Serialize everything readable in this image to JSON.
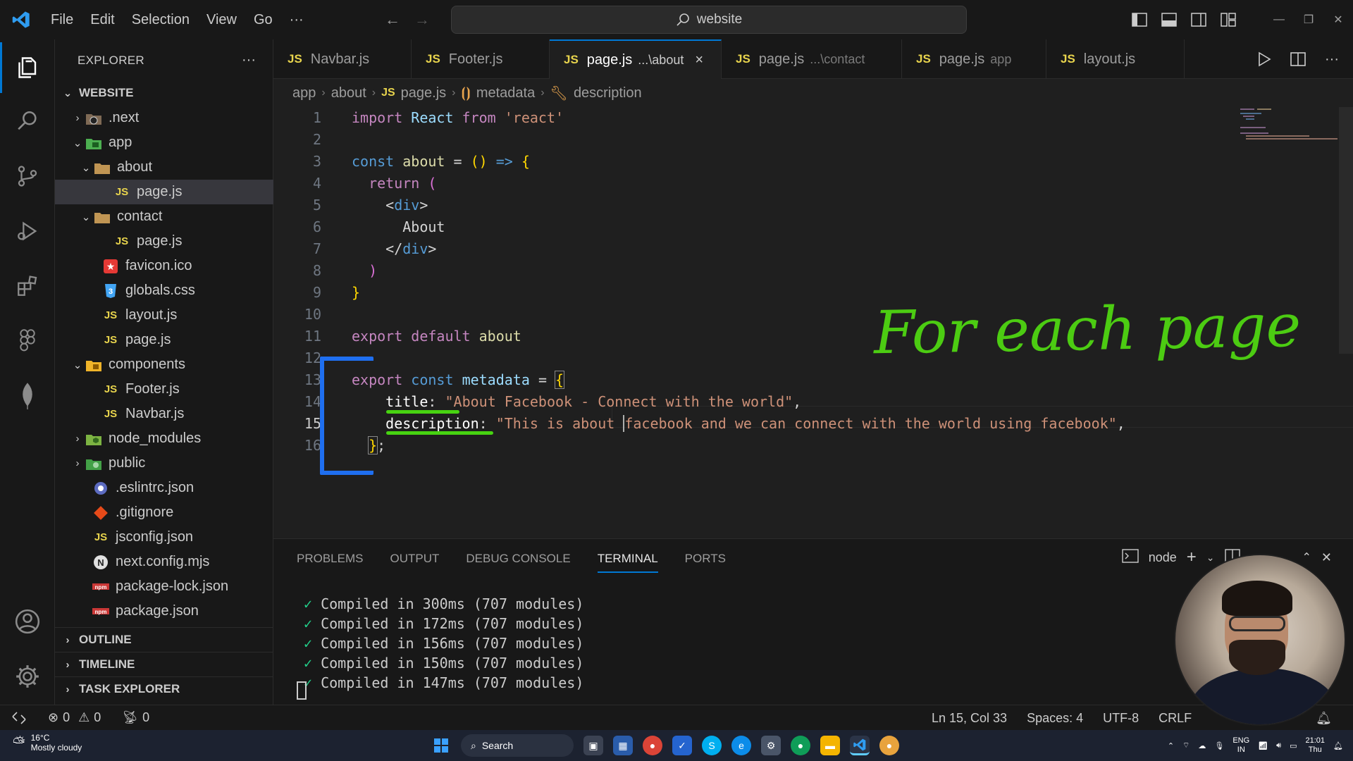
{
  "titlebar": {
    "menu": [
      "File",
      "Edit",
      "Selection",
      "View",
      "Go"
    ],
    "more": "···",
    "search_text": "website"
  },
  "sidebar": {
    "title": "EXPLORER",
    "more": "···",
    "root": "WEBSITE",
    "items": [
      {
        "label": ".next",
        "icon": "folder-next-icon"
      },
      {
        "label": "app",
        "icon": "folder-app-icon"
      },
      {
        "label": "about",
        "icon": "folder-icon"
      },
      {
        "label": "page.js",
        "icon": "js-file-icon"
      },
      {
        "label": "contact",
        "icon": "folder-icon"
      },
      {
        "label": "page.js",
        "icon": "js-file-icon"
      },
      {
        "label": "favicon.ico",
        "icon": "star-file-icon"
      },
      {
        "label": "globals.css",
        "icon": "css-file-icon"
      },
      {
        "label": "layout.js",
        "icon": "js-file-icon"
      },
      {
        "label": "page.js",
        "icon": "js-file-icon"
      },
      {
        "label": "components",
        "icon": "folder-components-icon"
      },
      {
        "label": "Footer.js",
        "icon": "js-file-icon"
      },
      {
        "label": "Navbar.js",
        "icon": "js-file-icon"
      },
      {
        "label": "node_modules",
        "icon": "folder-node-icon"
      },
      {
        "label": "public",
        "icon": "folder-public-icon"
      },
      {
        "label": ".eslintrc.json",
        "icon": "eslint-file-icon"
      },
      {
        "label": ".gitignore",
        "icon": "git-file-icon"
      },
      {
        "label": "jsconfig.json",
        "icon": "json-file-icon"
      },
      {
        "label": "next.config.mjs",
        "icon": "next-file-icon"
      },
      {
        "label": "package-lock.json",
        "icon": "npm-file-icon"
      },
      {
        "label": "package.json",
        "icon": "npm-file-icon"
      }
    ],
    "sections": [
      "OUTLINE",
      "TIMELINE",
      "TASK EXPLORER"
    ]
  },
  "tabs": [
    {
      "label": "Navbar.js",
      "desc": "",
      "icon": "JS"
    },
    {
      "label": "Footer.js",
      "desc": "",
      "icon": "JS"
    },
    {
      "label": "page.js",
      "desc": "...\\about",
      "icon": "JS",
      "close": "×"
    },
    {
      "label": "page.js",
      "desc": "...\\contact",
      "icon": "JS"
    },
    {
      "label": "page.js",
      "desc": "app",
      "icon": "JS"
    },
    {
      "label": "layout.js",
      "desc": "",
      "icon": "JS"
    }
  ],
  "breadcrumb": [
    "app",
    "about",
    "page.js",
    "metadata",
    "description"
  ],
  "editor": {
    "line_numbers": [
      "1",
      "2",
      "3",
      "4",
      "5",
      "6",
      "7",
      "8",
      "9",
      "10",
      "11",
      "12",
      "13",
      "14",
      "15",
      "16"
    ],
    "current_line": 15
  },
  "panel": {
    "tabs": [
      "PROBLEMS",
      "OUTPUT",
      "DEBUG CONSOLE",
      "TERMINAL",
      "PORTS"
    ],
    "terminal_name": "node",
    "terminal_lines": [
      "Compiled in 300ms (707 modules)",
      "Compiled in 172ms (707 modules)",
      "Compiled in 156ms (707 modules)",
      "Compiled in 150ms (707 modules)",
      "Compiled in 147ms (707 modules)"
    ]
  },
  "statusbar": {
    "errors": "0",
    "warnings": "0",
    "ports": "0",
    "position": "Ln 15, Col 33",
    "spaces": "Spaces: 4",
    "encoding": "UTF-8",
    "eol": "CRLF"
  },
  "annotation": {
    "handwriting": "For each page"
  },
  "taskbar": {
    "temperature": "16°C",
    "weather": "Mostly cloudy",
    "search": "Search",
    "lang1": "ENG",
    "lang2": "IN",
    "time": "21:01",
    "day": "Thu"
  },
  "colors": {
    "accent": "#0078d4",
    "annotation_green": "#4ccc12",
    "annotation_blue": "#1f6ff0"
  }
}
